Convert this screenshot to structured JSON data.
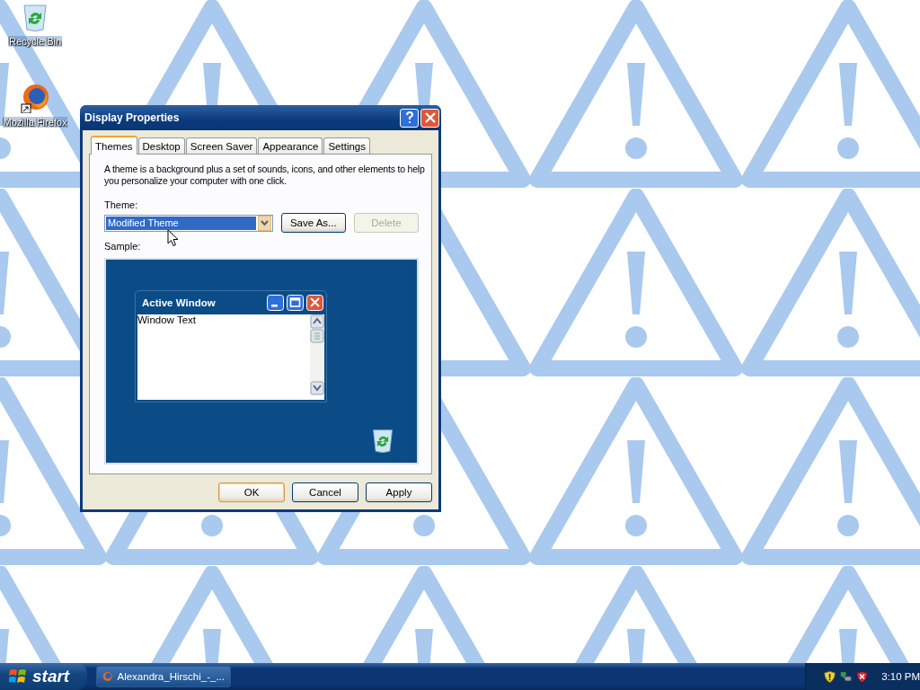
{
  "desktop_icons": [
    {
      "label": "Recycle Bin",
      "kind": "recycle"
    },
    {
      "label": "Mozilla Firefox",
      "kind": "firefox"
    }
  ],
  "dialog": {
    "title": "Display Properties",
    "tabs": [
      {
        "label": "Themes",
        "selected": true
      },
      {
        "label": "Desktop",
        "selected": false
      },
      {
        "label": "Screen Saver",
        "selected": false
      },
      {
        "label": "Appearance",
        "selected": false
      },
      {
        "label": "Settings",
        "selected": false
      }
    ],
    "description": "A theme is a background plus a set of sounds, icons, and other elements to help you personalize your computer with one click.",
    "theme_label": "Theme:",
    "theme_value": "Modified Theme",
    "side_buttons": [
      {
        "label": "Save As...",
        "disabled": false
      },
      {
        "label": "Delete",
        "disabled": true
      }
    ],
    "sample_label": "Sample:",
    "sample": {
      "window_title": "Active Window",
      "window_text": "Window Text"
    },
    "buttons": [
      {
        "label": "OK",
        "default": true
      },
      {
        "label": "Cancel",
        "default": false
      },
      {
        "label": "Apply",
        "default": false
      }
    ]
  },
  "taskbar": {
    "start": "start",
    "tasks": [
      {
        "label": "Alexandra_Hirschi_-_..."
      }
    ],
    "clock": "3:10 PM"
  }
}
